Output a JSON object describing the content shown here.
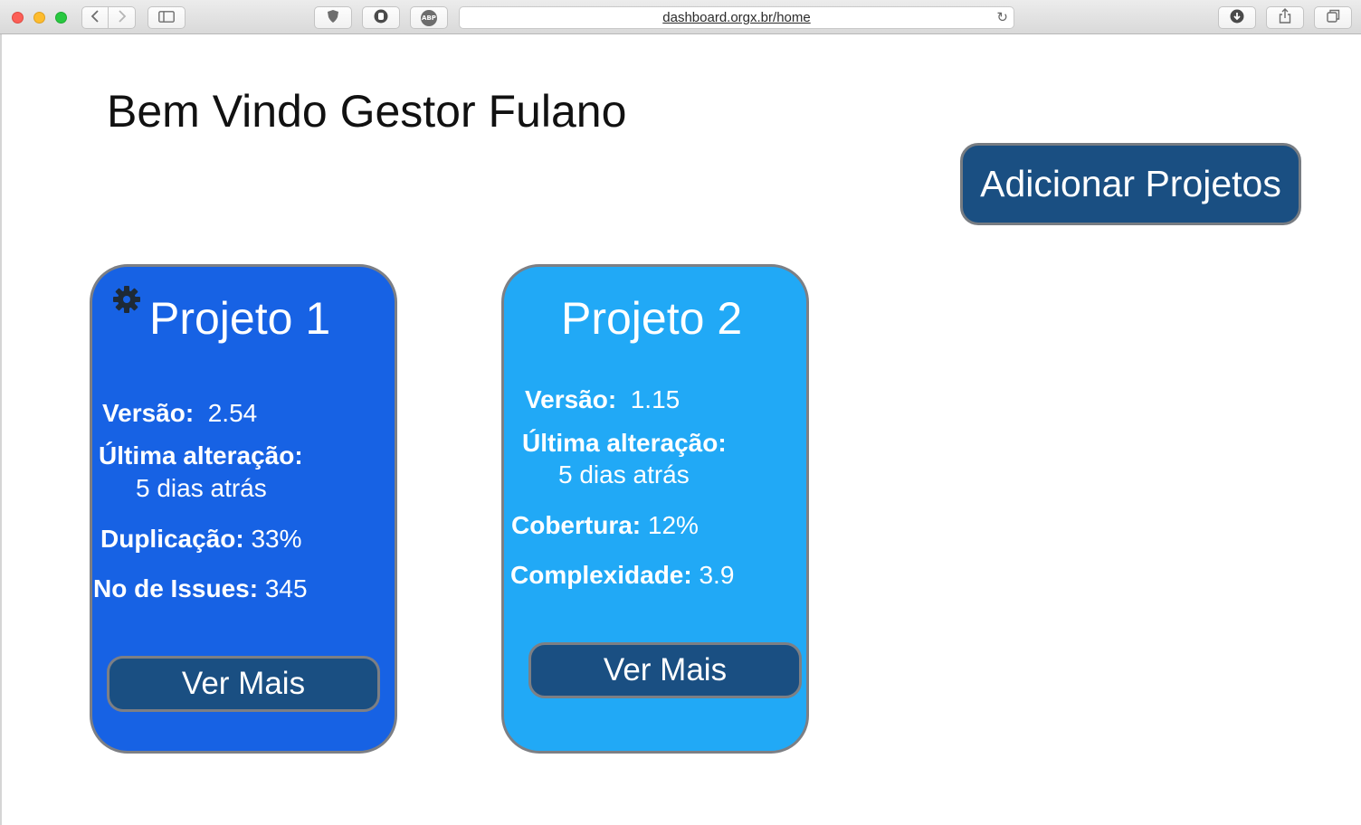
{
  "browser": {
    "url": "dashboard.orgx.br/home",
    "icons": [
      "back-icon",
      "forward-icon",
      "sidebar-icon",
      "shield-icon",
      "hand-icon",
      "abp-icon",
      "reload-icon",
      "download-icon",
      "share-icon",
      "tabs-icon"
    ],
    "abp_label": "ABP"
  },
  "page": {
    "welcome": "Bem Vindo Gestor Fulano",
    "add_button": "Adicionar Projetos"
  },
  "projects": [
    {
      "title": "Projeto 1",
      "color": "#1762e4",
      "version_label": "Versão:",
      "version": "2.54",
      "last_change_label": "Última alteração:",
      "last_change": "5 dias atrás",
      "metric1_label": "Duplicação:",
      "metric1_value": "33%",
      "metric2_label": "No de Issues:",
      "metric2_value": "345",
      "button": "Ver Mais",
      "has_settings_icon": true
    },
    {
      "title": "Projeto 2",
      "color": "#21a9f6",
      "version_label": "Versão:",
      "version": "1.15",
      "last_change_label": "Última alteração:",
      "last_change": "5 dias atrás",
      "metric1_label": "Cobertura:",
      "metric1_value": "12%",
      "metric2_label": "Complexidade:",
      "metric2_value": "3.9",
      "button": "Ver Mais",
      "has_settings_icon": false
    }
  ],
  "colors": {
    "button_bg": "#1a4f82",
    "card_border": "#7d7f84"
  }
}
